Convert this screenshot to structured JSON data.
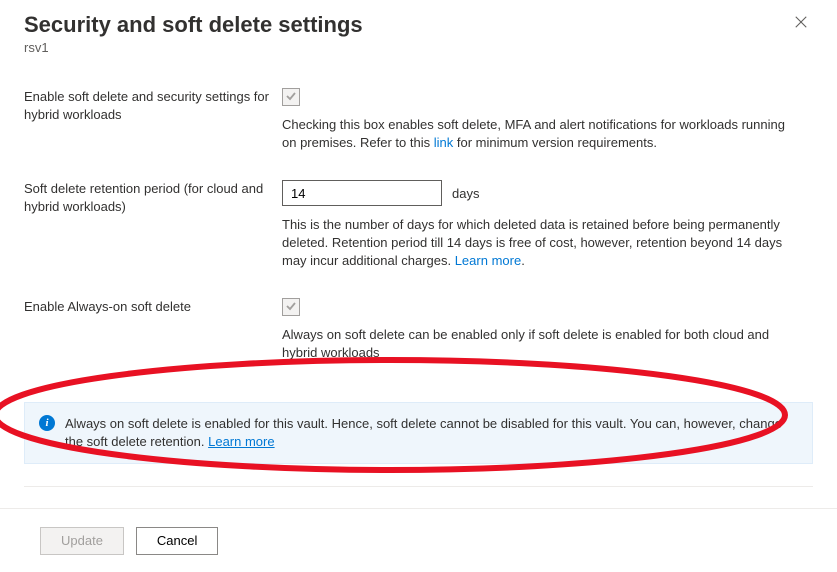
{
  "header": {
    "title": "Security and soft delete settings",
    "subtitle": "rsv1"
  },
  "fields": {
    "hybrid": {
      "label": "Enable soft delete and security settings for hybrid workloads",
      "help_pre": "Checking this box enables soft delete, MFA and alert notifications for workloads running on premises. Refer to this ",
      "help_link": "link",
      "help_post": " for minimum version requirements."
    },
    "retention": {
      "label": "Soft delete retention period (for cloud and hybrid workloads)",
      "value": "14",
      "unit": "days",
      "help_pre": "This is the number of days for which deleted data is retained before being permanently deleted. Retention period till 14 days is free of cost, however, retention beyond 14 days may incur additional charges. ",
      "help_link": "Learn more",
      "help_post": "."
    },
    "always_on": {
      "label": "Enable Always-on soft delete",
      "help": "Always on soft delete can be enabled only if soft delete is enabled for both cloud and hybrid workloads"
    }
  },
  "banner": {
    "text_pre": "Always on soft delete is enabled for this vault. Hence, soft delete cannot be disabled for this vault. You can, however, change the soft delete retention. ",
    "link": "Learn more"
  },
  "footer": {
    "update": "Update",
    "cancel": "Cancel"
  }
}
